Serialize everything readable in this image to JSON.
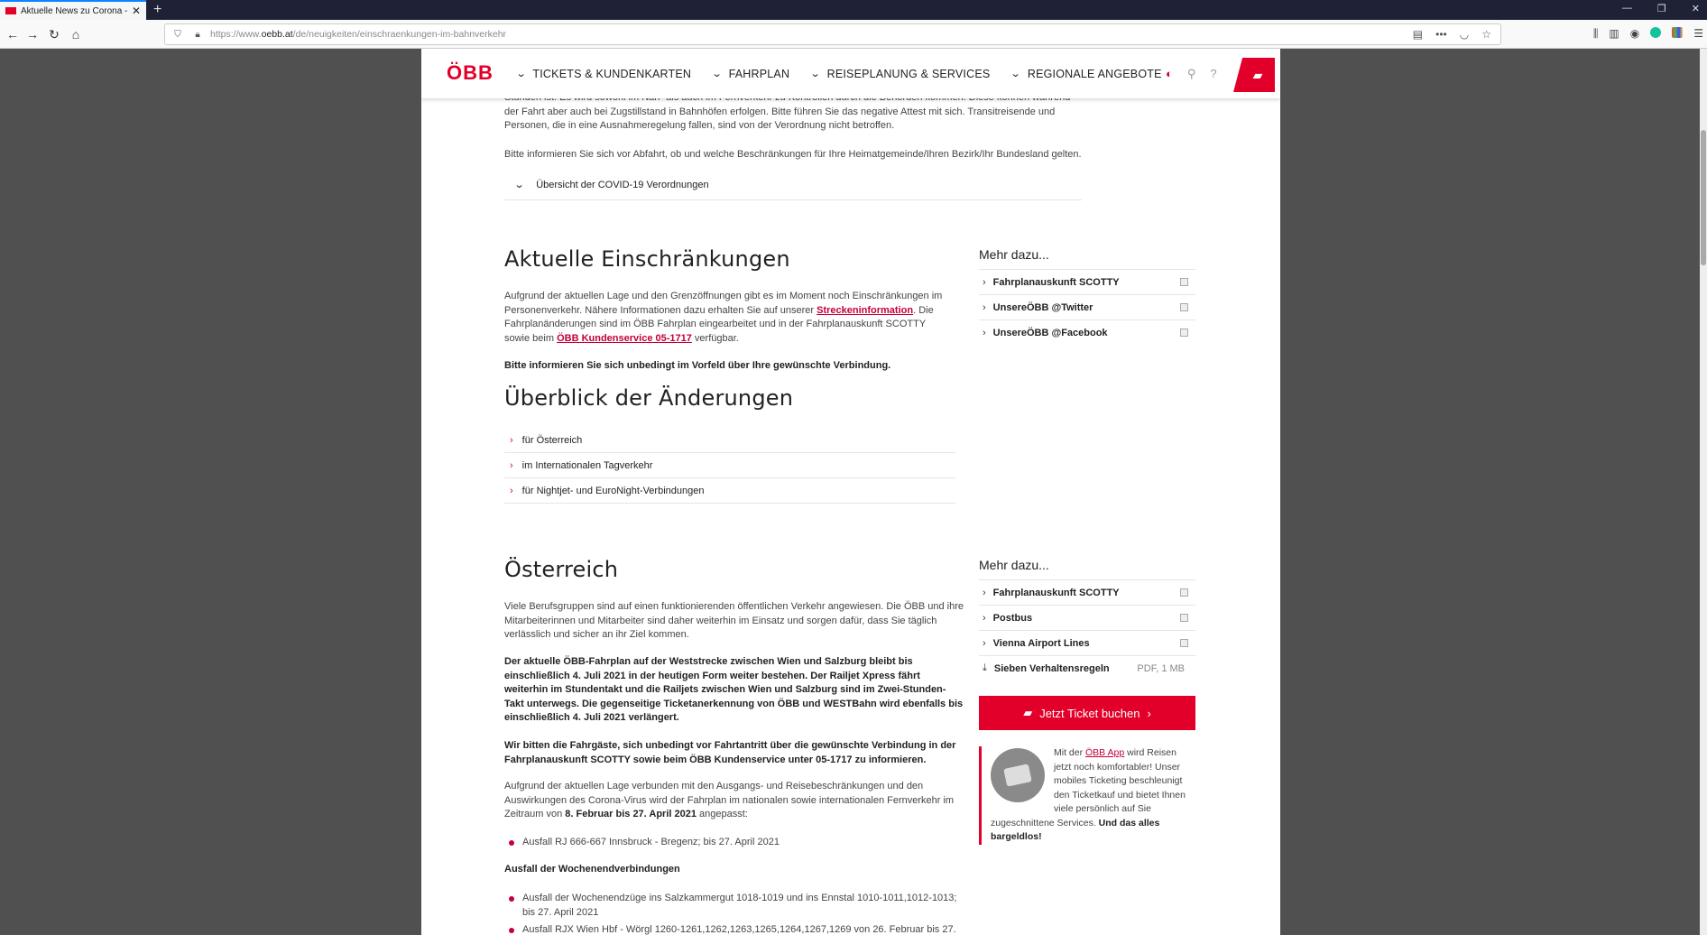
{
  "browser": {
    "tab_title": "Aktuelle News zu Corona - ÖBB",
    "tab_close": "✕",
    "new_tab": "+",
    "url_prefix": "https://www.",
    "url_host": "oebb.at",
    "url_path": "/de/neuigkeiten/einschraenkungen-im-bahnverkehr",
    "menu_dots": "•••"
  },
  "header": {
    "logo": "ÖBB",
    "nav": [
      {
        "label": "TICKETS & KUNDENKARTEN"
      },
      {
        "label": "FAHRPLAN"
      },
      {
        "label": "REISEPLANUNG & SERVICES"
      },
      {
        "label": "REGIONALE ANGEBOTE"
      }
    ]
  },
  "intro": {
    "text_top": "Stunden ist. Es wird sowohl im Nah- als auch im Fernverkehr zu Kontrollen durch die Behörden kommen. Diese können während der Fahrt aber auch bei Zugstillstand in Bahnhöfen erfolgen. Bitte führen Sie das negative Attest mit sich. Transitreisende und Personen, die in eine Ausnahmeregelung fallen, sind von der Verordnung nicht betroffen.",
    "text_info": "Bitte informieren Sie sich vor Abfahrt, ob und welche Beschränkungen für Ihre Heimatgemeinde/Ihren Bezirk/Ihr Bundesland gelten.",
    "accordion": "Übersicht der COVID-19 Verordnungen"
  },
  "einschraenkungen": {
    "title": "Aktuelle Einschränkungen",
    "p1_a": "Aufgrund der aktuellen Lage und den Grenzöffnungen gibt es im Moment noch Einschränkungen im Personenverkehr. Nähere Informationen dazu erhalten Sie auf unserer ",
    "p1_link1": "Streckeninformation",
    "p1_b": ". Die Fahrplanänderungen sind im ÖBB Fahrplan eingearbeitet und in der Fahrplanauskunft SCOTTY sowie beim ",
    "p1_link2": "ÖBB Kundenservice 05-1717",
    "p1_c": " verfügbar.",
    "p2": "Bitte informieren Sie sich unbedingt im Vorfeld über Ihre gewünschte Verbindung."
  },
  "ueberblick": {
    "title": "Überblick der Änderungen",
    "items": [
      {
        "label": "für Österreich"
      },
      {
        "label": "im Internationalen Tagverkehr"
      },
      {
        "label": "für Nightjet- und EuroNight-Verbindungen"
      }
    ]
  },
  "sidebar1": {
    "title": "Mehr dazu...",
    "links": [
      {
        "label": "Fahrplanauskunft SCOTTY"
      },
      {
        "label": "UnsereÖBB @Twitter"
      },
      {
        "label": "UnsereÖBB @Facebook"
      }
    ]
  },
  "oesterreich": {
    "title": "Österreich",
    "p1": "Viele Berufsgruppen sind auf einen funktionierenden öffentlichen Verkehr angewiesen. Die ÖBB und ihre Mitarbeiterinnen und Mitarbeiter sind daher weiterhin im Einsatz und sorgen dafür, dass Sie täglich verlässlich und sicher an ihr Ziel kommen.",
    "p2": "Der aktuelle ÖBB-Fahrplan auf der Weststrecke zwischen Wien und Salzburg bleibt bis einschließlich 4. Juli 2021 in der heutigen Form weiter bestehen. Der Railjet Xpress fährt weiterhin im Stundentakt und die Railjets zwischen Wien und Salzburg sind im Zwei-Stunden-Takt unterwegs. Die gegenseitige Ticketanerkennung von ÖBB und WESTBahn wird ebenfalls bis einschließlich 4. Juli 2021 verlängert.",
    "p3": "Wir bitten die Fahrgäste, sich unbedingt vor Fahrtantritt über die gewünschte Verbindung in der Fahrplanauskunft SCOTTY sowie beim ÖBB Kundenservice unter 05-1717 zu informieren.",
    "p4_a": "Aufgrund der aktuellen Lage verbunden mit den Ausgangs- und Reisebeschränkungen und den Auswirkungen des Corona-Virus wird der Fahrplan im nationalen sowie internationalen Fernverkehr im Zeitraum von ",
    "p4_bold": "8. Februar bis 27. April 2021",
    "p4_b": " angepasst:",
    "bullet1": "Ausfall RJ 666-667 Innsbruck - Bregenz; bis 27. April 2021",
    "subhead": "Ausfall der Wochenendverbindungen",
    "bullet2": "Ausfall der Wochenendzüge ins Salzkammergut 1018-1019 und ins Ennstal 1010-1011,1012-1013; bis 27. April 2021",
    "bullet3": "Ausfall RJX Wien Hbf - Wörgl 1260-1261,1262,1263,1265,1264,1267,1269 von 26. Februar bis 27."
  },
  "sidebar2": {
    "title": "Mehr dazu...",
    "links": [
      {
        "label": "Fahrplanauskunft SCOTTY"
      },
      {
        "label": "Postbus"
      },
      {
        "label": "Vienna Airport Lines"
      }
    ],
    "download": {
      "label": "Sieben Verhaltensregeln",
      "meta": "PDF, 1 MB"
    },
    "cta": "Jetzt Ticket buchen",
    "promo_a": "Mit der ",
    "promo_link": "ÖBB App",
    "promo_b": " wird Reisen jetzt noch komfortabler! Unser mobiles Ticketing beschleunigt den Ticketkauf und bietet Ihnen viele persönlich auf Sie zugeschnittene Services. ",
    "promo_bold": "Und das alles bargeldlos!"
  },
  "colors": {
    "brand": "#e2002a",
    "link": "#c4003a"
  }
}
